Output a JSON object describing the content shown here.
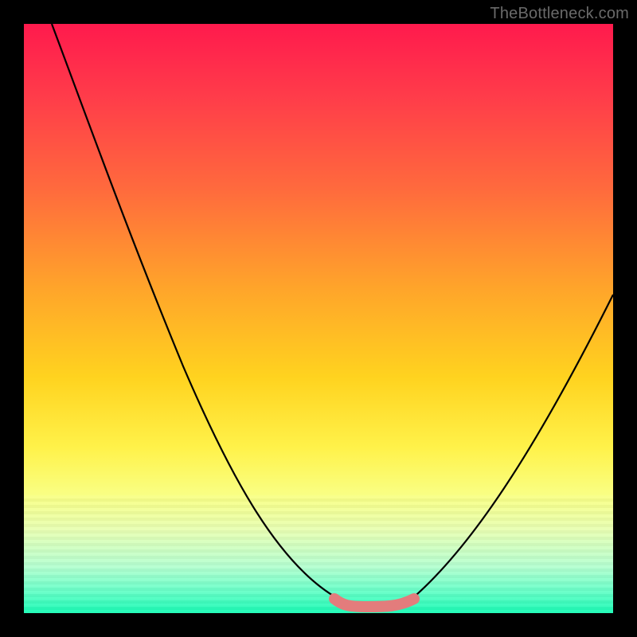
{
  "watermark": "TheBottleneck.com",
  "colors": {
    "page_bg": "#000000",
    "highlight_stroke": "#e37c7c",
    "curve_stroke": "#000000"
  },
  "chart_data": {
    "type": "line",
    "title": "",
    "xlabel": "",
    "ylabel": "",
    "xlim": [
      0,
      100
    ],
    "ylim": [
      0,
      100
    ],
    "grid": false,
    "legend": false,
    "annotations": [
      "TheBottleneck.com"
    ],
    "series": [
      {
        "name": "bottleneck-curve",
        "x": [
          0,
          10,
          20,
          30,
          40,
          50,
          55,
          60,
          65,
          70,
          80,
          90,
          100
        ],
        "values": [
          100,
          84,
          66,
          48,
          30,
          12,
          3,
          0,
          0,
          6,
          22,
          38,
          54
        ]
      }
    ],
    "highlight_flat_segment": {
      "x_start": 54,
      "x_end": 66,
      "y": 0
    }
  }
}
